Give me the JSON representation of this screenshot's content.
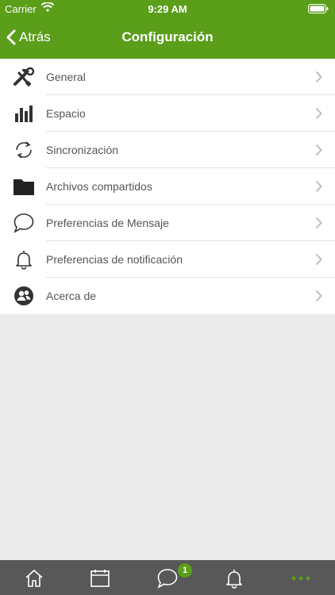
{
  "status_bar": {
    "carrier": "Carrier",
    "time": "9:29 AM"
  },
  "nav": {
    "back_label": "Atrás",
    "title": "Configuración"
  },
  "settings": {
    "items": [
      {
        "label": "General",
        "icon": "tools-icon"
      },
      {
        "label": "Espacio",
        "icon": "bar-chart-icon"
      },
      {
        "label": "Sincronización",
        "icon": "sync-icon"
      },
      {
        "label": "Archivos compartidos",
        "icon": "folder-icon"
      },
      {
        "label": "Preferencias de Mensaje",
        "icon": "chat-bubble-icon"
      },
      {
        "label": "Preferencias de notificación",
        "icon": "bell-icon"
      },
      {
        "label": "Acerca de",
        "icon": "users-icon"
      }
    ]
  },
  "tab_bar": {
    "tabs": [
      {
        "icon": "home-icon"
      },
      {
        "icon": "calendar-icon"
      },
      {
        "icon": "chat-bubble-icon",
        "badge": "1"
      },
      {
        "icon": "bell-icon"
      },
      {
        "icon": "more-icon",
        "active": true
      }
    ]
  },
  "colors": {
    "brand_green": "#5a9e1a",
    "tabbar_bg": "#585858",
    "background": "#ebebeb"
  }
}
